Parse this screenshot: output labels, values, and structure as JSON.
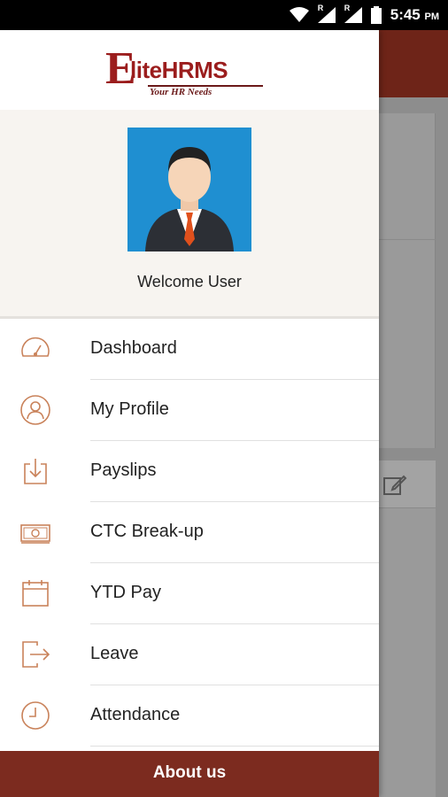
{
  "status_bar": {
    "time": "5:45",
    "ampm": "PM",
    "network_badge_1": "R",
    "network_badge_2": "R"
  },
  "logo": {
    "letter": "E",
    "text_lite": "lite",
    "text_hrms": "HRMS",
    "tagline": "Your HR Needs"
  },
  "profile": {
    "welcome": "Welcome User"
  },
  "menu": [
    {
      "label": "Dashboard",
      "icon": "speedometer-icon"
    },
    {
      "label": "My Profile",
      "icon": "user-icon"
    },
    {
      "label": "Payslips",
      "icon": "download-icon"
    },
    {
      "label": "CTC Break-up",
      "icon": "money-icon"
    },
    {
      "label": "YTD Pay",
      "icon": "calendar-icon"
    },
    {
      "label": "Leave",
      "icon": "exit-icon"
    },
    {
      "label": "Attendance",
      "icon": "clock-icon"
    }
  ],
  "footer": {
    "about_label": "About us"
  },
  "colors": {
    "accent": "#7c2b1f",
    "icon": "#c9825a",
    "brand": "#9b1d1d"
  }
}
